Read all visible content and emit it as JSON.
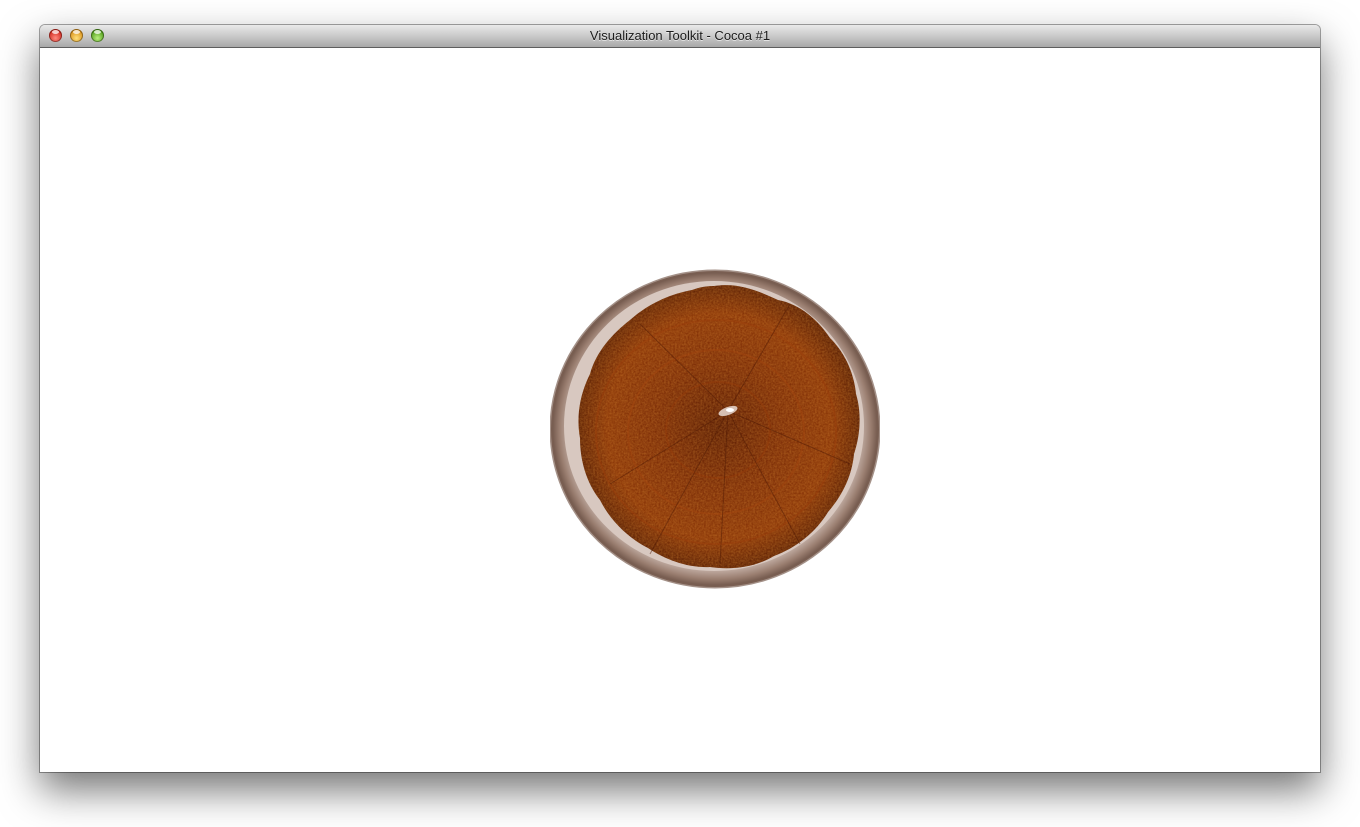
{
  "window": {
    "title": "Visualization Toolkit - Cocoa #1"
  },
  "controls": {
    "close": "close-button",
    "minimize": "minimize-button",
    "zoom": "zoom-button"
  },
  "colors": {
    "background": "#ffffff",
    "volume_core": "#7a2b06",
    "volume_rim": "#b8a39a"
  }
}
